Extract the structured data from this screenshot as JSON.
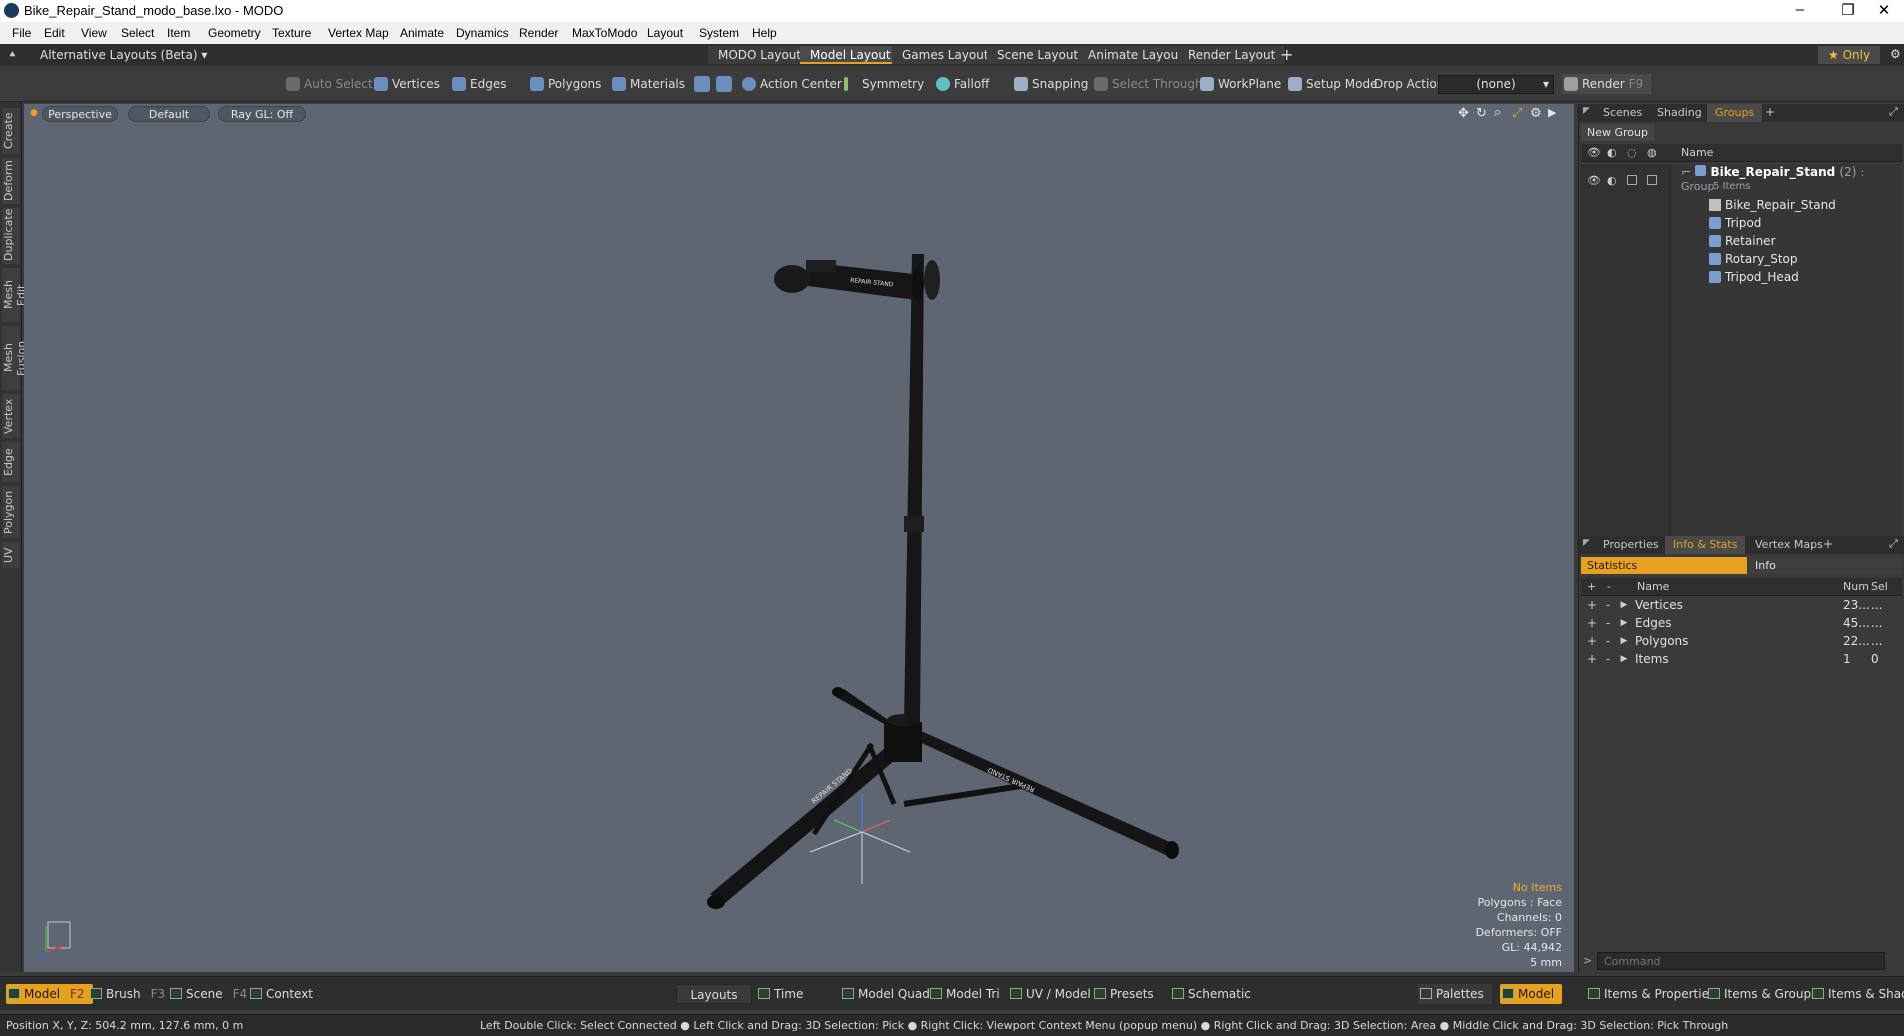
{
  "window": {
    "title": "Bike_Repair_Stand_modo_base.lxo - MODO",
    "minimize": "–",
    "maximize": "❐",
    "close": "✕"
  },
  "menu": [
    "File",
    "Edit",
    "View",
    "Select",
    "Item",
    "Geometry",
    "Texture",
    "Vertex Map",
    "Animate",
    "Dynamics",
    "Render",
    "MaxToModo",
    "Layout",
    "System",
    "Help"
  ],
  "layoutbar": {
    "alt_layouts": "Alternative Layouts (Beta) ▾",
    "tabs": [
      "MODO Layout",
      "Model Layout",
      "Games Layout",
      "Scene Layout",
      "Animate Layout",
      "Render Layout"
    ],
    "active_tab": "Model Layout",
    "add": "+",
    "only": "★ Only"
  },
  "toolbar": {
    "auto_select": "Auto Select",
    "vertices": "Vertices",
    "edges": "Edges",
    "polygons": "Polygons",
    "materials": "Materials",
    "action_center": "Action Center",
    "symmetry": "Symmetry",
    "falloff": "Falloff",
    "snapping": "Snapping",
    "select_through": "Select Through",
    "workplane": "WorkPlane",
    "setup_mode": "Setup Mode",
    "drop_action": "Drop Action",
    "drop_value": "(none)",
    "render": "Render",
    "render_key": "F9"
  },
  "left_tabs": [
    "Create",
    "Deform",
    "Duplicate",
    "Mesh Edit",
    "Mesh Fusion",
    "Vertex",
    "Edge",
    "Polygon",
    "UV"
  ],
  "viewport": {
    "view": "Perspective",
    "shading": "Default",
    "raygl": "Ray GL: Off",
    "stats": {
      "no_items": "No Items",
      "polygons": "Polygons : Face",
      "channels": "Channels: 0",
      "deformers": "Deformers: OFF",
      "gl": "GL: 44,942",
      "unit": "5 mm"
    },
    "model_labels": {
      "clamp": "REPAIR STAND",
      "leg_left": "REPAIR STAND",
      "leg_right": "REPAIR STAND"
    }
  },
  "scene_panel": {
    "tabs": [
      "Scenes",
      "Shading",
      "Groups"
    ],
    "active_tab": "Groups",
    "new_group": "New Group",
    "col_name": "Name",
    "group_name": "Bike_Repair_Stand",
    "group_count": "(2)",
    "group_type": ": Group",
    "group_items": "5 Items",
    "items": [
      "Bike_Repair_Stand",
      "Tripod",
      "Retainer",
      "Rotary_Stop",
      "Tripod_Head"
    ]
  },
  "info_panel": {
    "tabs": [
      "Properties",
      "Info & Stats",
      "Vertex Maps"
    ],
    "active_tab": "Info & Stats",
    "sub_tabs": [
      "Statistics",
      "Info"
    ],
    "col_name": "Name",
    "col_num": "Num",
    "col_sel": "Sel",
    "rows": [
      {
        "name": "Vertices",
        "num": "23...",
        "sel": "..."
      },
      {
        "name": "Edges",
        "num": "45...",
        "sel": "..."
      },
      {
        "name": "Polygons",
        "num": "22...",
        "sel": "..."
      },
      {
        "name": "Items",
        "num": "1",
        "sel": "0"
      }
    ],
    "command_placeholder": "Command"
  },
  "bottombar": {
    "model": "Model",
    "model_key": "F2",
    "brush": "Brush",
    "brush_key": "F3",
    "scene": "Scene",
    "scene_key": "F4",
    "context": "Context",
    "layouts": "Layouts",
    "time": "Time",
    "model_quad": "Model Quad",
    "model_tri": "Model Tri",
    "uv_model": "UV / Model",
    "presets": "Presets",
    "schematic": "Schematic",
    "palettes": "Palettes",
    "model_right": "Model",
    "items_props": "Items & Properties",
    "items_groups": "Items & Groups",
    "items_shading": "Items & Shading"
  },
  "status": {
    "position": "Position X, Y, Z:   504.2 mm, 127.6 mm, 0 m",
    "hint": "Left Double Click: Select Connected ● Left Click and Drag: 3D Selection: Pick ● Right Click: Viewport Context Menu (popup menu) ● Right Click and Drag: 3D Selection: Area ● Middle Click and Drag: 3D Selection: Pick Through"
  }
}
